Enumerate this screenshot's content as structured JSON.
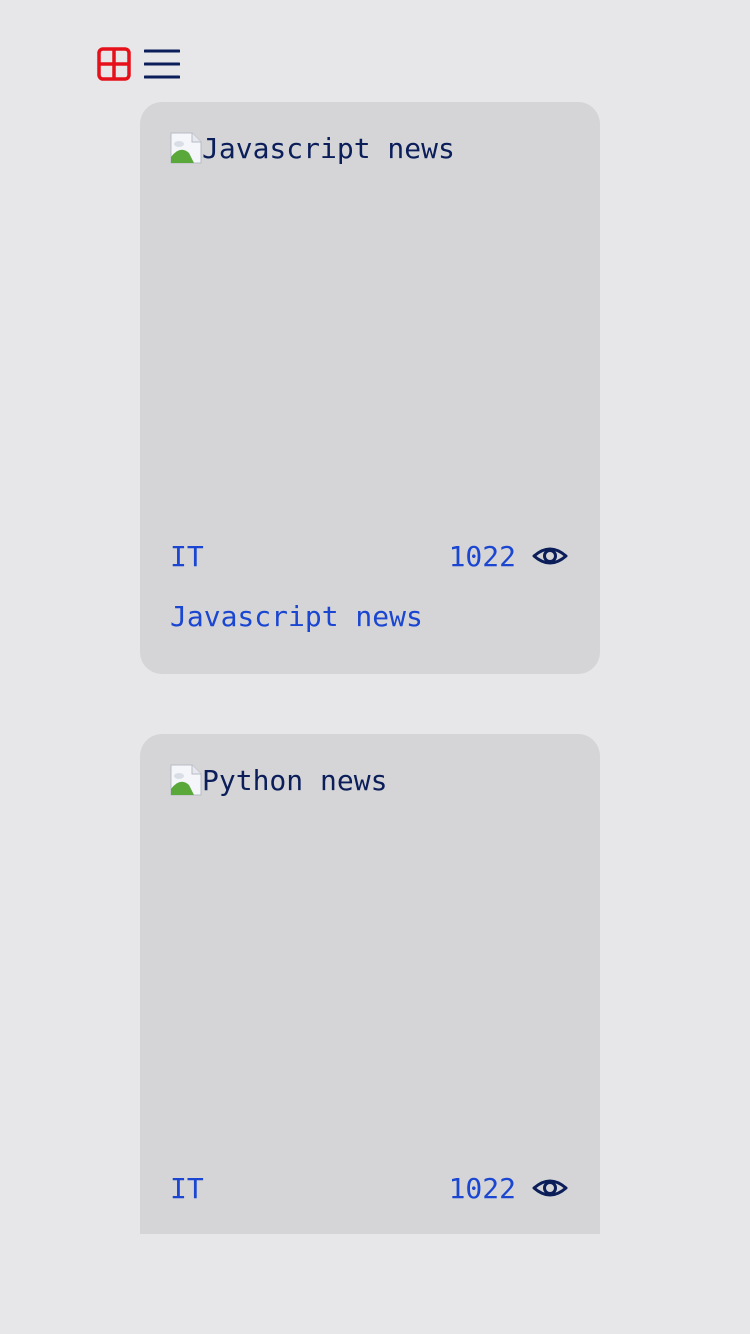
{
  "toolbar": {
    "grid_view_icon": "grid-icon",
    "list_view_icon": "list-icon",
    "active_view": "grid",
    "active_color": "#e5101a",
    "inactive_color": "#0b1e5a"
  },
  "articles": [
    {
      "image_alt": "Javascript news",
      "category": "IT",
      "views": "1022",
      "title": "Javascript news"
    },
    {
      "image_alt": "Python news",
      "category": "IT",
      "views": "1022"
    }
  ],
  "colors": {
    "background": "#e7e7e9",
    "card": "#d5d5d7",
    "link_text": "#1a46d1",
    "dark_text": "#0b1e5a"
  }
}
